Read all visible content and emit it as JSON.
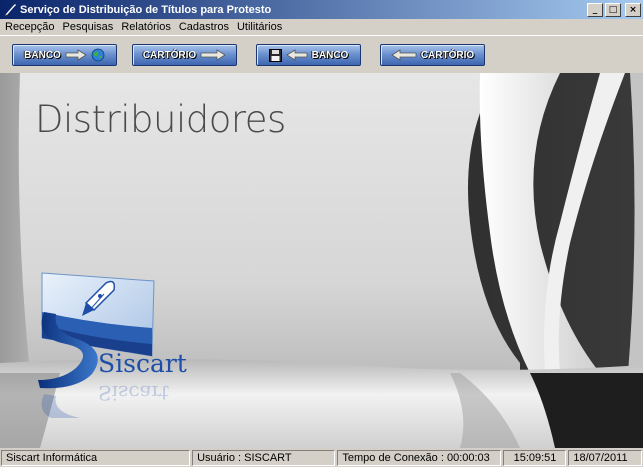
{
  "window": {
    "title": "Serviço de Distribuição de Títulos para Protesto",
    "minimize": "_",
    "maximize": "□",
    "close": "×"
  },
  "menu": [
    "Recepção",
    "Pesquisas",
    "Relatórios",
    "Cadastros",
    "Utilitários"
  ],
  "toolbar": {
    "btn1_label": "BANCO",
    "btn2_label": "CARTÓRIO",
    "btn3_label": "BANCO",
    "btn4_label": "CARTÓRIO"
  },
  "main": {
    "title": "Distribuidores",
    "logo_text": "Siscart",
    "logo_icon": "fountain-pen-icon"
  },
  "status": {
    "company": "Siscart Informática",
    "user": "Usuário : SISCART",
    "connection": "Tempo de Conexão : 00:00:03",
    "time": "15:09:51",
    "date": "18/07/2011"
  },
  "colors": {
    "titlebar_start": "#0a246a",
    "titlebar_end": "#a6caf0",
    "button_blue": "#3e66b0",
    "logo_blue": "#1e4fa8"
  }
}
